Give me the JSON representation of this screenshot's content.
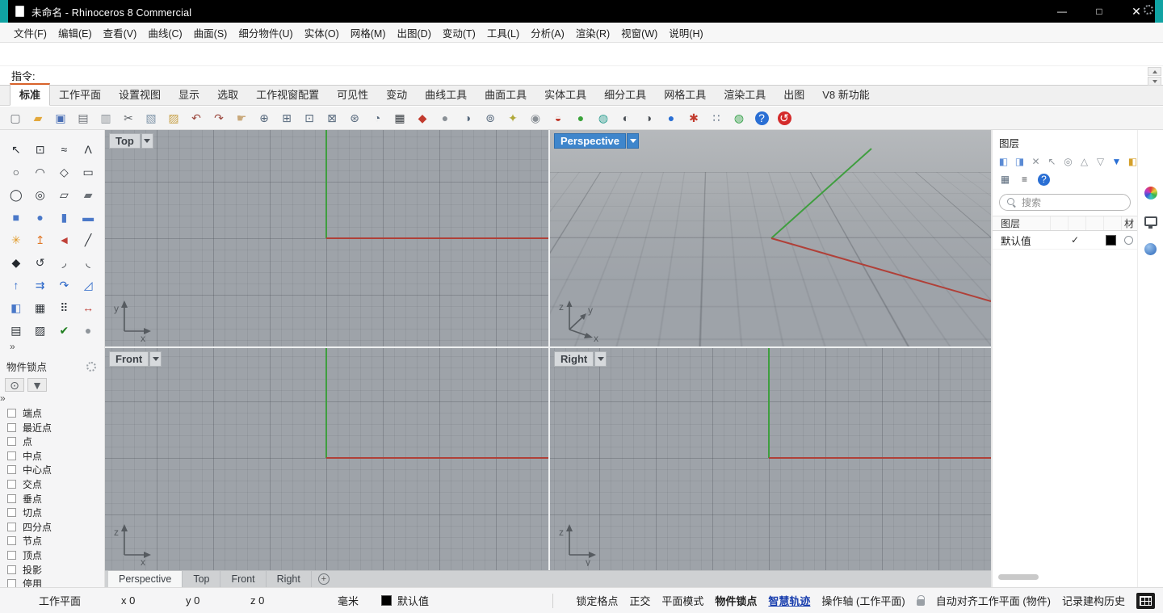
{
  "window": {
    "title": "未命名 - Rhinoceros 8 Commercial",
    "controls": {
      "minimize": "—",
      "maximize": "□",
      "close": "✕"
    }
  },
  "menu": {
    "items": [
      "文件(F)",
      "编辑(E)",
      "查看(V)",
      "曲线(C)",
      "曲面(S)",
      "细分物件(U)",
      "实体(O)",
      "网格(M)",
      "出图(D)",
      "变动(T)",
      "工具(L)",
      "分析(A)",
      "渲染(R)",
      "视窗(W)",
      "说明(H)"
    ]
  },
  "command": {
    "prompt": "指令:"
  },
  "ribbon": {
    "tabs": [
      {
        "label": "标准",
        "active": true
      },
      {
        "label": "工作平面"
      },
      {
        "label": "设置视图"
      },
      {
        "label": "显示"
      },
      {
        "label": "选取"
      },
      {
        "label": "工作视窗配置"
      },
      {
        "label": "可见性"
      },
      {
        "label": "变动"
      },
      {
        "label": "曲线工具"
      },
      {
        "label": "曲面工具"
      },
      {
        "label": "实体工具"
      },
      {
        "label": "细分工具"
      },
      {
        "label": "网格工具"
      },
      {
        "label": "渲染工具"
      },
      {
        "label": "出图"
      },
      {
        "label": "V8 新功能"
      }
    ]
  },
  "toolbar": {
    "icons": [
      {
        "name": "new-file-icon",
        "glyph": "▢",
        "color": "#6d7278"
      },
      {
        "name": "open-folder-icon",
        "glyph": "▰",
        "color": "#e3a83c"
      },
      {
        "name": "save-icon",
        "glyph": "▣",
        "color": "#4a6fb5"
      },
      {
        "name": "print-icon",
        "glyph": "▤",
        "color": "#6d7278"
      },
      {
        "name": "export-icon",
        "glyph": "▥",
        "color": "#8a9096"
      },
      {
        "name": "cut-icon",
        "glyph": "✂",
        "color": "#5a5f64"
      },
      {
        "name": "copy-icon",
        "glyph": "▧",
        "color": "#7f94a8"
      },
      {
        "name": "paste-icon",
        "glyph": "▨",
        "color": "#c8a24a"
      },
      {
        "name": "undo-icon",
        "glyph": "↶",
        "color": "#9c4a40"
      },
      {
        "name": "redo-icon",
        "glyph": "↷",
        "color": "#9c4a40"
      },
      {
        "name": "pan-icon",
        "glyph": "☛",
        "color": "#c9a97b"
      },
      {
        "name": "zoom-dynamic-icon",
        "glyph": "⊕",
        "color": "#56687c"
      },
      {
        "name": "zoom-window-icon",
        "glyph": "⊞",
        "color": "#56687c"
      },
      {
        "name": "zoom-selected-icon",
        "glyph": "⊡",
        "color": "#56687c"
      },
      {
        "name": "zoom-extents-icon",
        "glyph": "⊠",
        "color": "#56687c"
      },
      {
        "name": "zoom-extents-all-icon",
        "glyph": "⊛",
        "color": "#56687c"
      },
      {
        "name": "rotate-view-icon",
        "glyph": "◔",
        "color": "#56687c"
      },
      {
        "name": "viewport-layout-icon",
        "glyph": "▦",
        "color": "#3a3f44"
      },
      {
        "name": "display-mode-icon",
        "glyph": "◆",
        "color": "#c23b2e"
      },
      {
        "name": "shade-viewport-icon",
        "glyph": "●",
        "color": "#8a9096"
      },
      {
        "name": "rotate-camera-icon",
        "glyph": "◑",
        "color": "#56687c"
      },
      {
        "name": "zoom-target-icon",
        "glyph": "⊚",
        "color": "#56687c"
      },
      {
        "name": "light-icon",
        "glyph": "✦",
        "color": "#b0a838"
      },
      {
        "name": "lock-objects-icon",
        "glyph": "◉",
        "color": "#8a9096"
      },
      {
        "name": "layer-state-icon",
        "glyph": "◒",
        "color": "#c23b2e"
      },
      {
        "name": "render-icon",
        "glyph": "●",
        "color": "#3aa33a"
      },
      {
        "name": "render-preview-icon",
        "glyph": "◍",
        "color": "#2a9d8f"
      },
      {
        "name": "sun-icon",
        "glyph": "◐",
        "color": "#4a4f55"
      },
      {
        "name": "material-preview-icon",
        "glyph": "◑",
        "color": "#4a4f55"
      },
      {
        "name": "environment-icon",
        "glyph": "●",
        "color": "#2a6fd4"
      },
      {
        "name": "snapshot-icon",
        "glyph": "✱",
        "color": "#c23b2e"
      },
      {
        "name": "grid-options-icon",
        "glyph": "∷",
        "color": "#56687c"
      },
      {
        "name": "earth-icon",
        "glyph": "◍",
        "color": "#2f9e44"
      },
      {
        "name": "help-icon",
        "glyph": "?",
        "color": "#ffffff",
        "bg": "#2a6fd4"
      },
      {
        "name": "record-icon",
        "glyph": "↺",
        "color": "#ffffff",
        "bg": "#d42b2b"
      }
    ]
  },
  "sidebar": {
    "more": "»",
    "tools": [
      {
        "name": "select-icon",
        "glyph": "↖",
        "color": "#2f343a"
      },
      {
        "name": "select-points-icon",
        "glyph": "⊡",
        "color": "#2f343a"
      },
      {
        "name": "curve-icon",
        "glyph": "≈",
        "color": "#2f343a"
      },
      {
        "name": "polyline-icon",
        "glyph": "Λ",
        "color": "#2f343a"
      },
      {
        "name": "circle-icon",
        "glyph": "○",
        "color": "#2f343a"
      },
      {
        "name": "arc-icon",
        "glyph": "◠",
        "color": "#2f343a"
      },
      {
        "name": "polygon-icon",
        "glyph": "◇",
        "color": "#2f343a"
      },
      {
        "name": "rectangle-icon",
        "glyph": "▭",
        "color": "#2f343a"
      },
      {
        "name": "ellipse-icon",
        "glyph": "◯",
        "color": "#2f343a"
      },
      {
        "name": "offset-curve-icon",
        "glyph": "◎",
        "color": "#2f343a"
      },
      {
        "name": "surface-plane-icon",
        "glyph": "▱",
        "color": "#2f343a"
      },
      {
        "name": "surface-corner-icon",
        "glyph": "▰",
        "color": "#6d7278"
      },
      {
        "name": "box-icon",
        "glyph": "■",
        "color": "#4a78c8"
      },
      {
        "name": "sphere-icon",
        "glyph": "●",
        "color": "#4a78c8"
      },
      {
        "name": "cylinder-icon",
        "glyph": "▮",
        "color": "#4a78c8"
      },
      {
        "name": "slab-icon",
        "glyph": "▬",
        "color": "#4a78c8"
      },
      {
        "name": "explode-icon",
        "glyph": "✳",
        "color": "#e09a28"
      },
      {
        "name": "extrude-icon",
        "glyph": "↥",
        "color": "#e07828"
      },
      {
        "name": "trim-icon",
        "glyph": "◄",
        "color": "#c04038"
      },
      {
        "name": "split-icon",
        "glyph": "╱",
        "color": "#2f343a"
      },
      {
        "name": "blend-icon",
        "glyph": "◆",
        "color": "#23282d"
      },
      {
        "name": "rebuild-icon",
        "glyph": "↺",
        "color": "#2f343a"
      },
      {
        "name": "fillet-icon",
        "glyph": "◞",
        "color": "#2f343a"
      },
      {
        "name": "chamfer-icon",
        "glyph": "◟",
        "color": "#2f343a"
      },
      {
        "name": "move-icon",
        "glyph": "↑",
        "color": "#2a66c8"
      },
      {
        "name": "copy-object-icon",
        "glyph": "⇉",
        "color": "#2a66c8"
      },
      {
        "name": "rotate-object-icon",
        "glyph": "↷",
        "color": "#2a66c8"
      },
      {
        "name": "scale-icon",
        "glyph": "◿",
        "color": "#2a66c8"
      },
      {
        "name": "boolean-union-icon",
        "glyph": "◧",
        "color": "#4a78c8"
      },
      {
        "name": "mesh-icon",
        "glyph": "▦",
        "color": "#2f343a"
      },
      {
        "name": "array-icon",
        "glyph": "⠿",
        "color": "#2f343a"
      },
      {
        "name": "dimension-icon",
        "glyph": "↔",
        "color": "#c04038"
      },
      {
        "name": "text-icon",
        "glyph": "▤",
        "color": "#2f343a"
      },
      {
        "name": "hatch-icon",
        "glyph": "▨",
        "color": "#2f343a"
      },
      {
        "name": "check-icon",
        "glyph": "✔",
        "color": "#1e7e1e"
      },
      {
        "name": "render-sphere-icon",
        "glyph": "●",
        "color": "#8f959b"
      }
    ]
  },
  "osnap": {
    "title": "物件锁点",
    "more": "»",
    "buttons": [
      {
        "name": "osnap-toggle-icon",
        "glyph": "⊙",
        "color": "#5a5f64"
      },
      {
        "name": "osnap-filter-icon",
        "glyph": "▼",
        "color": "#5a5f64"
      }
    ],
    "items": [
      "端点",
      "最近点",
      "点",
      "中点",
      "中心点",
      "交点",
      "垂点",
      "切点",
      "四分点",
      "节点",
      "顶点",
      "投影",
      "停用"
    ]
  },
  "viewports": {
    "top": {
      "title": "Top",
      "axis_v": "y",
      "axis_h": "x"
    },
    "perspective": {
      "title": "Perspective",
      "axis_up": "z",
      "axis_mid": "y",
      "axis_right": "x"
    },
    "front": {
      "title": "Front",
      "axis_v": "z",
      "axis_h": "x"
    },
    "right": {
      "title": "Right",
      "axis_v": "z",
      "axis_h": "y"
    },
    "tabs": [
      {
        "label": "Perspective",
        "active": true
      },
      {
        "label": "Top"
      },
      {
        "label": "Front"
      },
      {
        "label": "Right"
      }
    ],
    "add_label": "+"
  },
  "layers": {
    "title": "图层",
    "toolbar": [
      {
        "name": "new-layer-icon",
        "glyph": "◧",
        "color": "#5b8bd4"
      },
      {
        "name": "new-sublayer-icon",
        "glyph": "◨",
        "color": "#5b8bd4"
      },
      {
        "name": "delete-layer-icon",
        "glyph": "✕",
        "color": "#8f959b"
      },
      {
        "name": "select-layer-objects-icon",
        "glyph": "↖",
        "color": "#8f959b"
      },
      {
        "name": "match-layer-icon",
        "glyph": "◎",
        "color": "#8f959b"
      },
      {
        "name": "move-layer-up-icon",
        "glyph": "△",
        "color": "#8f959b"
      },
      {
        "name": "move-layer-down-icon",
        "glyph": "▽",
        "color": "#8f959b"
      },
      {
        "name": "filter-layers-icon",
        "glyph": "▼",
        "color": "#2a6fd4"
      },
      {
        "name": "layer-tools-icon",
        "glyph": "◧",
        "color": "#d4a02a"
      }
    ],
    "toolbar2": [
      {
        "name": "table-view-icon",
        "glyph": "▦",
        "color": "#5b6b7c"
      },
      {
        "name": "list-view-icon",
        "glyph": "≡",
        "color": "#44484d"
      },
      {
        "name": "help-icon",
        "glyph": "?",
        "color": "#ffffff",
        "bg": "#2a6fd4"
      }
    ],
    "search_placeholder": "搜索",
    "columns": {
      "name": "图层",
      "material": "材"
    },
    "rows": [
      {
        "name": "默认值",
        "current": "✓",
        "color": "#000000"
      }
    ]
  },
  "statusbar": {
    "cplane": "工作平面",
    "coords": [
      "x 0",
      "y 0",
      "z 0"
    ],
    "units": "毫米",
    "layer": {
      "label": "默认值",
      "color": "#000000"
    },
    "toggles": [
      {
        "label": "锁定格点"
      },
      {
        "label": "正交"
      },
      {
        "label": "平面模式"
      },
      {
        "label": "物件锁点",
        "bold": true
      },
      {
        "label": "智慧轨迹",
        "bold": true,
        "accent": true
      }
    ],
    "gumball": "操作轴 (工作平面)",
    "auto_cplane": "自动对齐工作平面 (物件)",
    "history": "记录建构历史"
  },
  "colors": {
    "titlebar_teal": "#10a3a3",
    "viewport_bg": "#9ea3a9",
    "axis_red": "#b04038",
    "axis_green": "#3f9e3f",
    "active_viewport_blue": "#3f86cc"
  }
}
